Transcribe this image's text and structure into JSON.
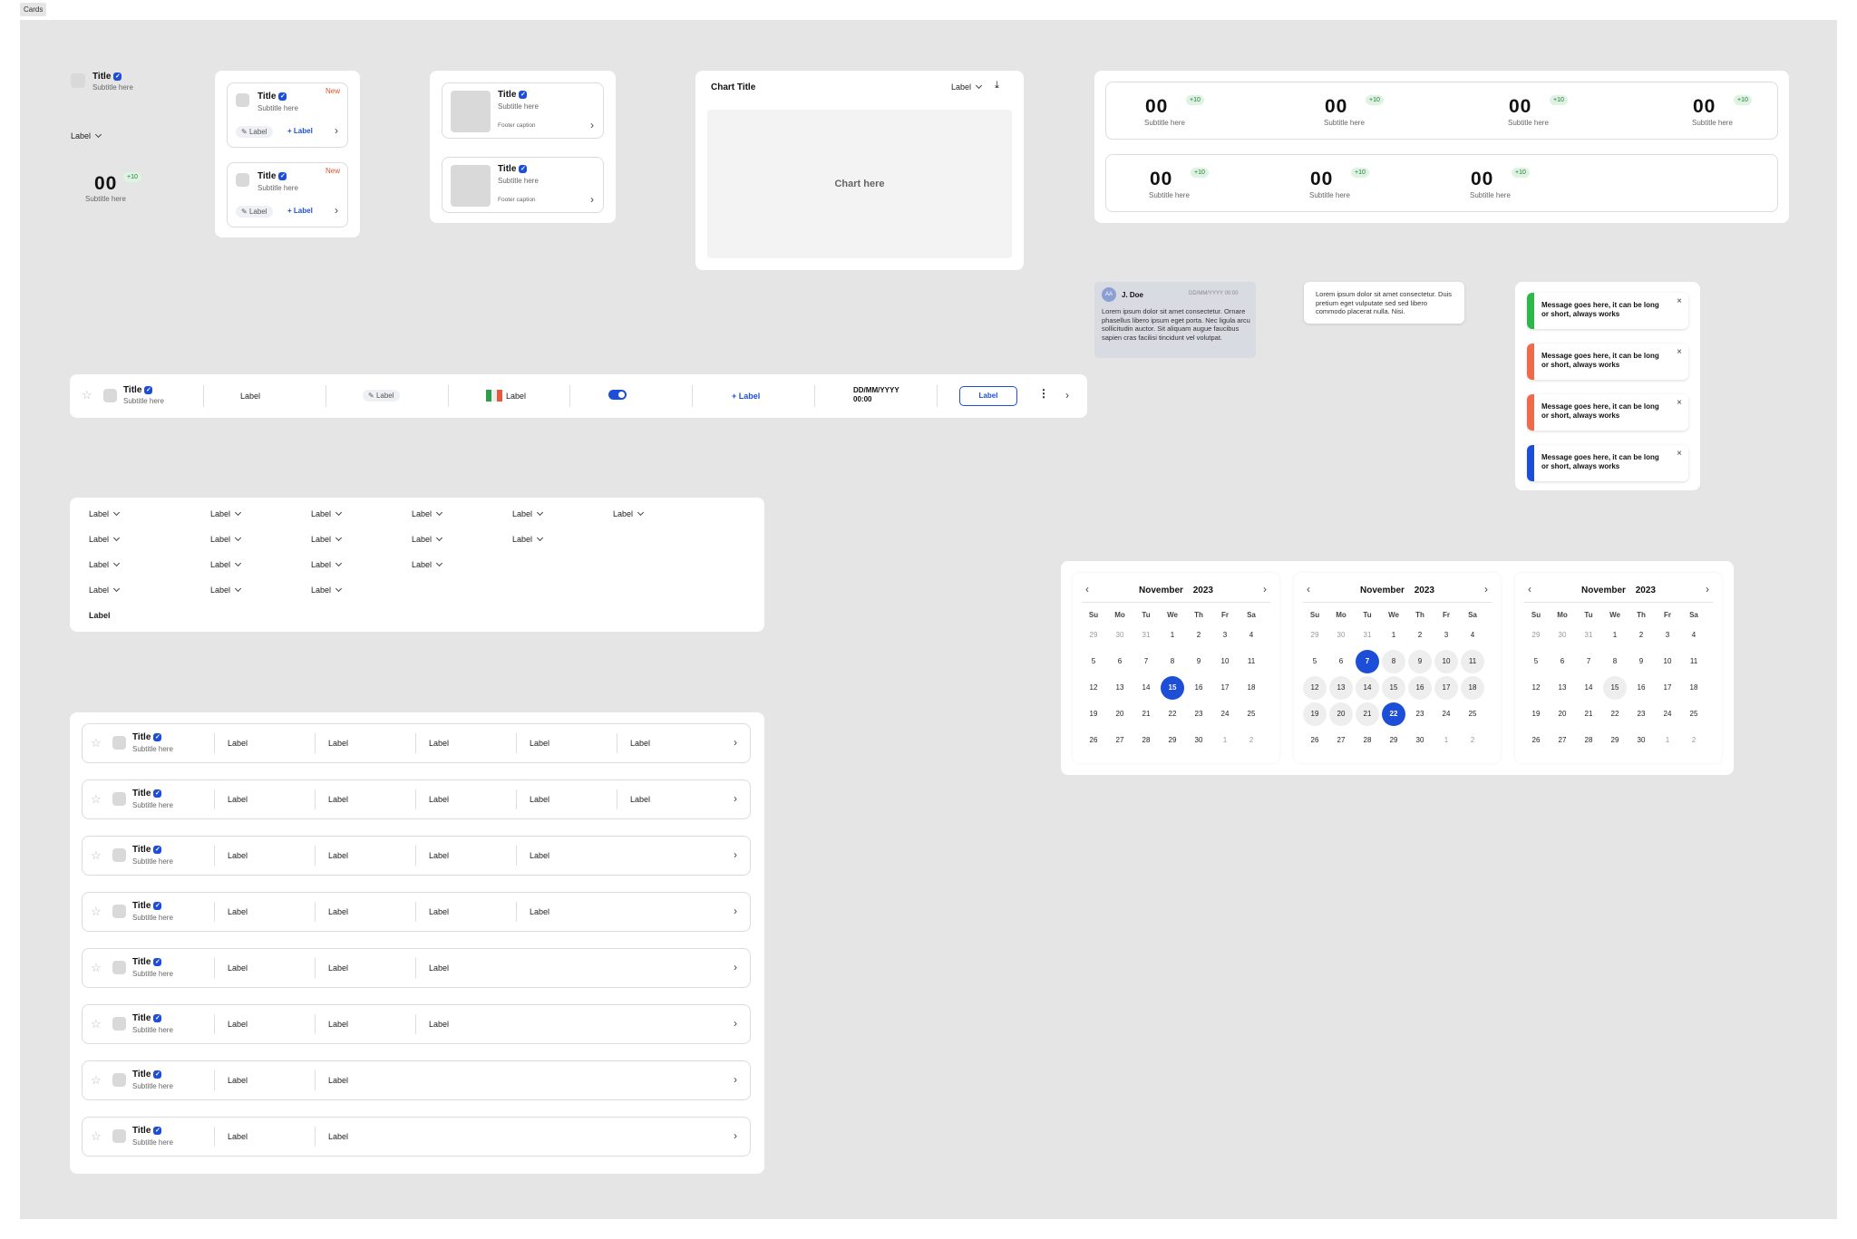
{
  "frame_label": "Cards",
  "verified_icon": "✓",
  "stat_card": {
    "title": "Title",
    "subtitle": "Subtitle here",
    "dropdown": "Label",
    "value": "00",
    "badge": "+10",
    "value_subtitle": "Subtitle here"
  },
  "list_card": {
    "items": [
      {
        "title": "Title",
        "subtitle": "Subtitle here",
        "badge": "New",
        "tag": "Label",
        "action": "+ Label"
      },
      {
        "title": "Title",
        "subtitle": "Subtitle here",
        "badge": "New",
        "tag": "Label",
        "action": "+ Label"
      }
    ]
  },
  "media_card": {
    "items": [
      {
        "title": "Title",
        "subtitle": "Subtitle here",
        "footer": "Footer caption"
      },
      {
        "title": "Title",
        "subtitle": "Subtitle here",
        "footer": "Footer caption"
      }
    ]
  },
  "chart_card": {
    "title": "Chart Title",
    "dropdown": "Label",
    "placeholder": "Chart here"
  },
  "kpi_row1": [
    {
      "value": "00",
      "badge": "+10",
      "subtitle": "Subtitle here"
    },
    {
      "value": "00",
      "badge": "+10",
      "subtitle": "Subtitle here"
    },
    {
      "value": "00",
      "badge": "+10",
      "subtitle": "Subtitle here"
    },
    {
      "value": "00",
      "badge": "+10",
      "subtitle": "Subtitle here"
    }
  ],
  "kpi_row2": [
    {
      "value": "00",
      "badge": "+10",
      "subtitle": "Subtitle here"
    },
    {
      "value": "00",
      "badge": "+10",
      "subtitle": "Subtitle here"
    },
    {
      "value": "00",
      "badge": "+10",
      "subtitle": "Subtitle here"
    }
  ],
  "comment": {
    "initials": "AA",
    "name": "J. Doe",
    "date": "DD/MM/YYYY 00:00",
    "text": "Lorem ipsum dolor sit amet consectetur. Ornare phasellus libero ipsum eget porta. Nec ligula arcu sollicitudin auctor. Sit aliquam augue faucibus sapien cras facilisi tincidunt vel volutpat."
  },
  "tooltip": {
    "text": "Lorem ipsum dolor sit amet consectetur. Duis pretium eget vulputate sed sed libero commodo placerat nulla. Nisi."
  },
  "toasts": [
    {
      "message": "Message goes here, it can be long or short, always works",
      "color": "#2eb84b"
    },
    {
      "message": "Message goes here, it can be long or short, always works",
      "color": "#ee6a4a"
    },
    {
      "message": "Message goes here, it can be long or short, always works",
      "color": "#ee6a4a"
    },
    {
      "message": "Message goes here, it can be long or short, always works",
      "color": "#1d4ed8"
    }
  ],
  "wide_row": {
    "title": "Title",
    "subtitle": "Subtitle here",
    "label1": "Label",
    "tag": "Label",
    "flag_label": "Label",
    "add": "+ Label",
    "date": "DD/MM/YYYY",
    "time": "00:00",
    "button": "Label"
  },
  "filters": {
    "rows": [
      [
        "Label",
        "Label",
        "Label",
        "Label",
        "Label",
        "Label"
      ],
      [
        "Label",
        "Label",
        "Label",
        "Label",
        "Label"
      ],
      [
        "Label",
        "Label",
        "Label",
        "Label"
      ],
      [
        "Label",
        "Label",
        "Label"
      ]
    ],
    "footer": "Label"
  },
  "table_rows": [
    {
      "title": "Title",
      "subtitle": "Subtitle here",
      "labels": [
        "Label",
        "Label",
        "Label",
        "Label",
        "Label"
      ]
    },
    {
      "title": "Title",
      "subtitle": "Subtitle here",
      "labels": [
        "Label",
        "Label",
        "Label",
        "Label",
        "Label"
      ]
    },
    {
      "title": "Title",
      "subtitle": "Subtitle here",
      "labels": [
        "Label",
        "Label",
        "Label",
        "Label"
      ]
    },
    {
      "title": "Title",
      "subtitle": "Subtitle here",
      "labels": [
        "Label",
        "Label",
        "Label",
        "Label"
      ]
    },
    {
      "title": "Title",
      "subtitle": "Subtitle here",
      "labels": [
        "Label",
        "Label",
        "Label"
      ]
    },
    {
      "title": "Title",
      "subtitle": "Subtitle here",
      "labels": [
        "Label",
        "Label",
        "Label"
      ]
    },
    {
      "title": "Title",
      "subtitle": "Subtitle here",
      "labels": [
        "Label",
        "Label"
      ]
    },
    {
      "title": "Title",
      "subtitle": "Subtitle here",
      "labels": [
        "Label",
        "Label"
      ]
    }
  ],
  "calendars": [
    {
      "month": "November",
      "year": "2023",
      "selected": [
        15
      ],
      "range": []
    },
    {
      "month": "November",
      "year": "2023",
      "selected": [
        7,
        22
      ],
      "range": [
        8,
        9,
        10,
        11,
        12,
        13,
        14,
        15,
        16,
        17,
        18,
        19,
        20,
        21
      ]
    },
    {
      "month": "November",
      "year": "2023",
      "selected": [],
      "range": [],
      "today": 15
    }
  ],
  "weekdays": [
    "Su",
    "Mo",
    "Tu",
    "We",
    "Th",
    "Fr",
    "Sa"
  ],
  "calendar_days": [
    [
      "29",
      "30",
      "31",
      "1",
      "2",
      "3",
      "4"
    ],
    [
      "5",
      "6",
      "7",
      "8",
      "9",
      "10",
      "11"
    ],
    [
      "12",
      "13",
      "14",
      "15",
      "16",
      "17",
      "18"
    ],
    [
      "19",
      "20",
      "21",
      "22",
      "23",
      "24",
      "25"
    ],
    [
      "26",
      "27",
      "28",
      "29",
      "30",
      "1",
      "2"
    ]
  ]
}
